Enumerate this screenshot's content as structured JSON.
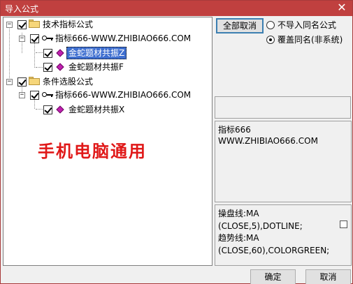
{
  "window": {
    "title": "导入公式",
    "close_glyph": "✕"
  },
  "tree": {
    "group1": {
      "label": "技术指标公式",
      "formula": "指标666-WWW.ZHIBIAO666.COM",
      "items": [
        "金蛇题材共振Z",
        "金蛇题材共振F"
      ]
    },
    "group2": {
      "label": "条件选股公式",
      "formula": "指标666-WWW.ZHIBIAO666.COM",
      "items": [
        "金蛇题材共振X"
      ]
    },
    "expander_minus": "−"
  },
  "watermark": "手机电脑通用",
  "options": {
    "deselect_all": "全部取消",
    "radio_skip": "不导入同名公式",
    "radio_overwrite": "覆盖同名(非系统)",
    "selected": "radio_overwrite"
  },
  "info_panel": {
    "line1": "指标666",
    "line2": "WWW.ZHIBIAO666.COM"
  },
  "code_panel": {
    "line1": "操盘线:MA",
    "line2": "(CLOSE,5),DOTLINE;",
    "line3": "趋势线:MA",
    "line4": "(CLOSE,60),COLORGREEN;"
  },
  "footer": {
    "ok": "确定",
    "cancel": "取消"
  }
}
